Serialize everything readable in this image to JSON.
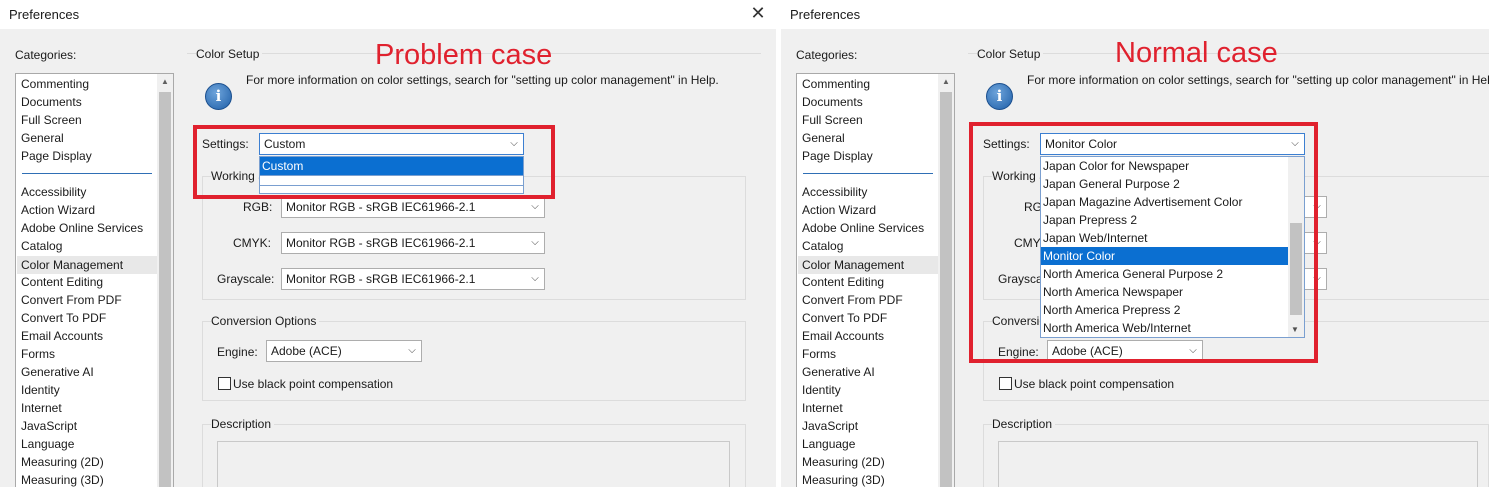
{
  "left": {
    "window_title": "Preferences",
    "annotation": "Problem case",
    "settings_value": "Custom",
    "dropdown_items": [
      "Custom"
    ]
  },
  "right": {
    "window_title": "Preferences",
    "annotation": "Normal case",
    "settings_value": "Monitor Color",
    "dropdown_items": [
      "Japan Color for Newspaper",
      "Japan General Purpose 2",
      "Japan Magazine Advertisement Color",
      "Japan Prepress 2",
      "Japan Web/Internet",
      "Monitor Color",
      "North America General Purpose 2",
      "North America Newspaper",
      "North America Prepress 2",
      "North America Web/Internet"
    ]
  },
  "close_glyph": "✕",
  "categories_label": "Categories:",
  "categories_group1": [
    "Commenting",
    "Documents",
    "Full Screen",
    "General",
    "Page Display"
  ],
  "categories_group2": [
    "Accessibility",
    "Action Wizard",
    "Adobe Online Services",
    "Catalog",
    "Color Management",
    "Content Editing",
    "Convert From PDF",
    "Convert To PDF",
    "Email Accounts",
    "Forms",
    "Generative AI",
    "Identity",
    "Internet",
    "JavaScript",
    "Language",
    "Measuring (2D)",
    "Measuring (3D)"
  ],
  "selected_category": "Color Management",
  "color_setup_label": "Color Setup",
  "info_text": "For more information on color settings, search for \"setting up color management\" in Help.",
  "settings_label": "Settings:",
  "working_spaces_label": "Working Spaces",
  "working_spaces_short": "Working S",
  "rgb_label": "RGB:",
  "cmyk_label": "CMYK:",
  "grayscale_label": "Grayscale:",
  "profile_value": "Monitor RGB - sRGB IEC61966-2.1",
  "conversion_options_label": "Conversion Options",
  "conversion_short": "Conversio",
  "engine_label": "Engine:",
  "engine_value": "Adobe (ACE)",
  "black_point_label": "Use black point compensation",
  "description_label": "Description",
  "icons": {
    "info": "info-icon",
    "chevron": "chevron-down-icon",
    "close": "close-icon",
    "scroll_up": "scroll-up-arrow-icon",
    "scroll_down": "scroll-down-arrow-icon"
  },
  "colors": {
    "annotation_red": "#e0212e",
    "selection_blue": "#0b6fd1",
    "panel_bg": "#f0f0f0"
  }
}
